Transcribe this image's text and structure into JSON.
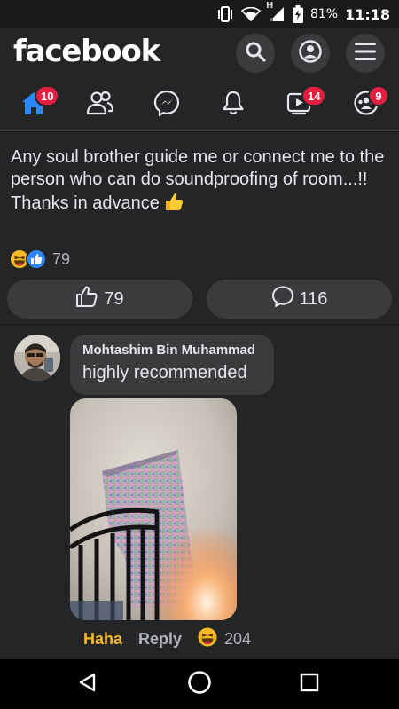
{
  "status_bar": {
    "battery_percent": "81%",
    "time": "11:18",
    "network_label": "H"
  },
  "header": {
    "logo": "facebook",
    "buttons": [
      "search-icon",
      "profile-icon",
      "menu-icon"
    ]
  },
  "nav_tabs": [
    {
      "name": "home",
      "icon": "home-icon",
      "badge": "10",
      "active": true
    },
    {
      "name": "friends",
      "icon": "friends-icon",
      "badge": ""
    },
    {
      "name": "messenger",
      "icon": "messenger-icon",
      "badge": ""
    },
    {
      "name": "notifications",
      "icon": "bell-icon",
      "badge": ""
    },
    {
      "name": "watch",
      "icon": "video-icon",
      "badge": "14"
    },
    {
      "name": "groups",
      "icon": "groups-icon",
      "badge": "9"
    }
  ],
  "post": {
    "text": "Any soul brother guide me or connect me to the person who can do soundproofing of room...!!",
    "text_line2": "Thanks in advance",
    "reaction_count": "79",
    "like_count": "79",
    "comment_count": "116"
  },
  "comment": {
    "author": "Mohtashim Bin Muhammad",
    "text": "highly recommended",
    "haha_label": "Haha",
    "reply_label": "Reply",
    "reaction_count": "204"
  },
  "colors": {
    "background": "#18191a",
    "surface": "#242526",
    "control": "#3a3b3c",
    "accent_blue": "#2d88ff",
    "badge_red": "#e41e3f",
    "haha_yellow": "#f7b928"
  }
}
